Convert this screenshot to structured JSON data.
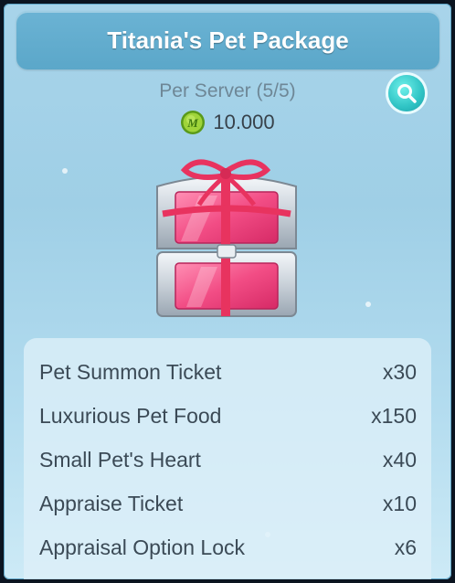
{
  "window": {
    "title": "Titania's Pet Package",
    "accent_color": "#5ba7c9"
  },
  "purchase_limit": {
    "text": "Per Server (5/5)"
  },
  "price": {
    "currency_icon": "m-coin-icon",
    "amount": "10.000"
  },
  "zoom_button": {
    "icon": "magnifier-icon"
  },
  "package_image": {
    "icon": "gift-chest-icon"
  },
  "items": [
    {
      "name": "Pet Summon Ticket",
      "qty": "x30"
    },
    {
      "name": "Luxurious Pet Food",
      "qty": "x150"
    },
    {
      "name": "Small Pet's Heart",
      "qty": "x40"
    },
    {
      "name": "Appraise Ticket",
      "qty": "x10"
    },
    {
      "name": "Appraisal Option Lock",
      "qty": "x6"
    }
  ]
}
